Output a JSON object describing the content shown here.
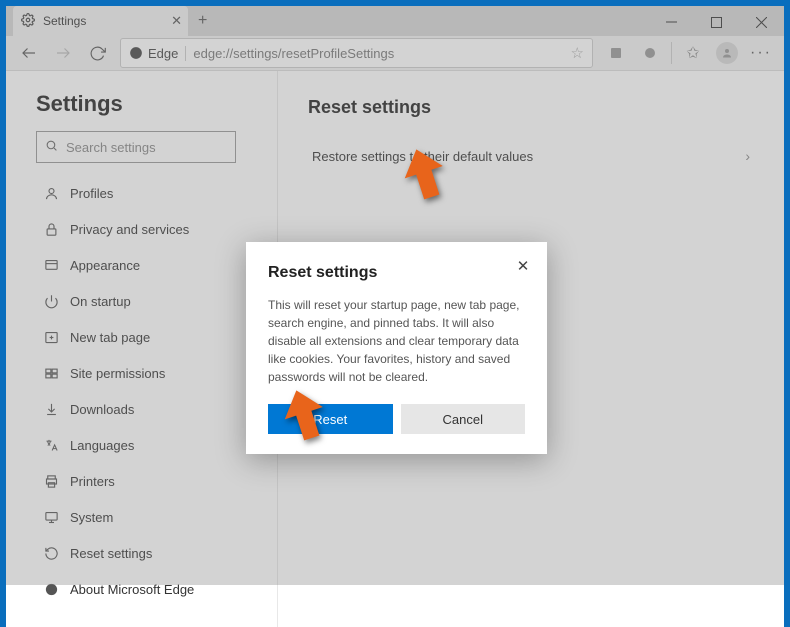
{
  "tab": {
    "title": "Settings"
  },
  "addressbar": {
    "brand": "Edge",
    "url": "edge://settings/resetProfileSettings"
  },
  "sidebar": {
    "title": "Settings",
    "search_placeholder": "Search settings",
    "items": [
      {
        "label": "Profiles"
      },
      {
        "label": "Privacy and services"
      },
      {
        "label": "Appearance"
      },
      {
        "label": "On startup"
      },
      {
        "label": "New tab page"
      },
      {
        "label": "Site permissions"
      },
      {
        "label": "Downloads"
      },
      {
        "label": "Languages"
      },
      {
        "label": "Printers"
      },
      {
        "label": "System"
      },
      {
        "label": "Reset settings"
      },
      {
        "label": "About Microsoft Edge"
      }
    ]
  },
  "main": {
    "title": "Reset settings",
    "restore_label": "Restore settings to their default values"
  },
  "dialog": {
    "title": "Reset settings",
    "body": "This will reset your startup page, new tab page, search engine, and pinned tabs. It will also disable all extensions and clear temporary data like cookies. Your favorites, history and saved passwords will not be cleared.",
    "reset_label": "Reset",
    "cancel_label": "Cancel"
  }
}
